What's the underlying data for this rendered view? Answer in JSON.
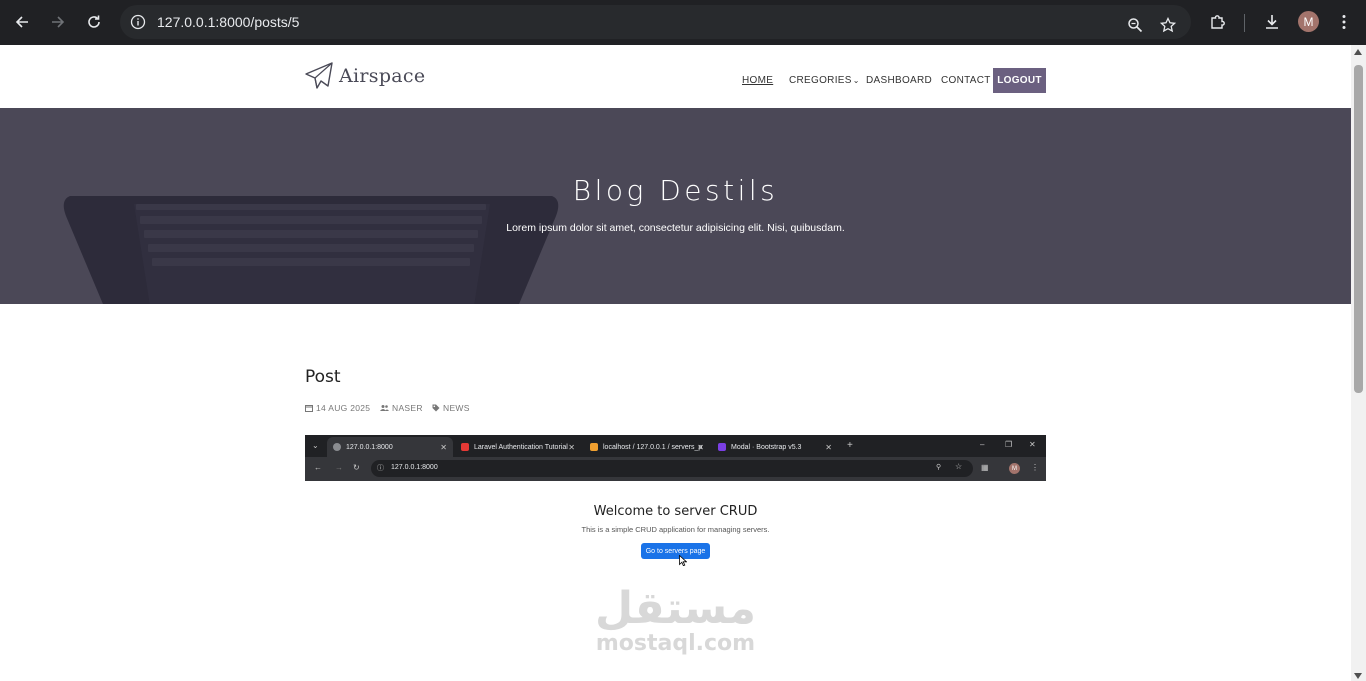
{
  "browser": {
    "url_host": "127.0.0.1",
    "url_rest": ":8000/posts/5",
    "profile_initial": "M"
  },
  "site": {
    "brand": "Airspace",
    "nav": [
      {
        "label": "HOME",
        "active": true
      },
      {
        "label": "CREGORIES"
      },
      {
        "label": "DASHBOARD"
      },
      {
        "label": "CONTACT"
      }
    ],
    "logout_label": "LOGOUT"
  },
  "hero": {
    "title": "Blog Destils",
    "subtitle": "Lorem ipsum dolor sit amet, consectetur adipisicing elit. Nisi, quibusdam."
  },
  "post": {
    "title": "Post",
    "date": "14 AUG 2025",
    "author": "NASER",
    "tag": "NEWS"
  },
  "post_image": {
    "tabs": [
      {
        "label": "127.0.0.1:8000",
        "active": true
      },
      {
        "label": "Laravel Authentication Tutorial"
      },
      {
        "label": "localhost / 127.0.0.1 / servers_p"
      },
      {
        "label": "Modal · Bootstrap v5.3"
      }
    ],
    "url": "127.0.0.1:8000",
    "profile_initial": "M",
    "heading": "Welcome to server CRUD",
    "subheading": "This is a simple CRUD application for managing servers.",
    "button_label": "Go to servers page",
    "watermark_ar": "مستقل",
    "watermark_en": "mostaql.com"
  },
  "colors": {
    "hero_bg": "#4b4857",
    "logout_bg": "#6b6080",
    "chrome_bg": "#202124",
    "button_blue": "#1a73e8"
  }
}
